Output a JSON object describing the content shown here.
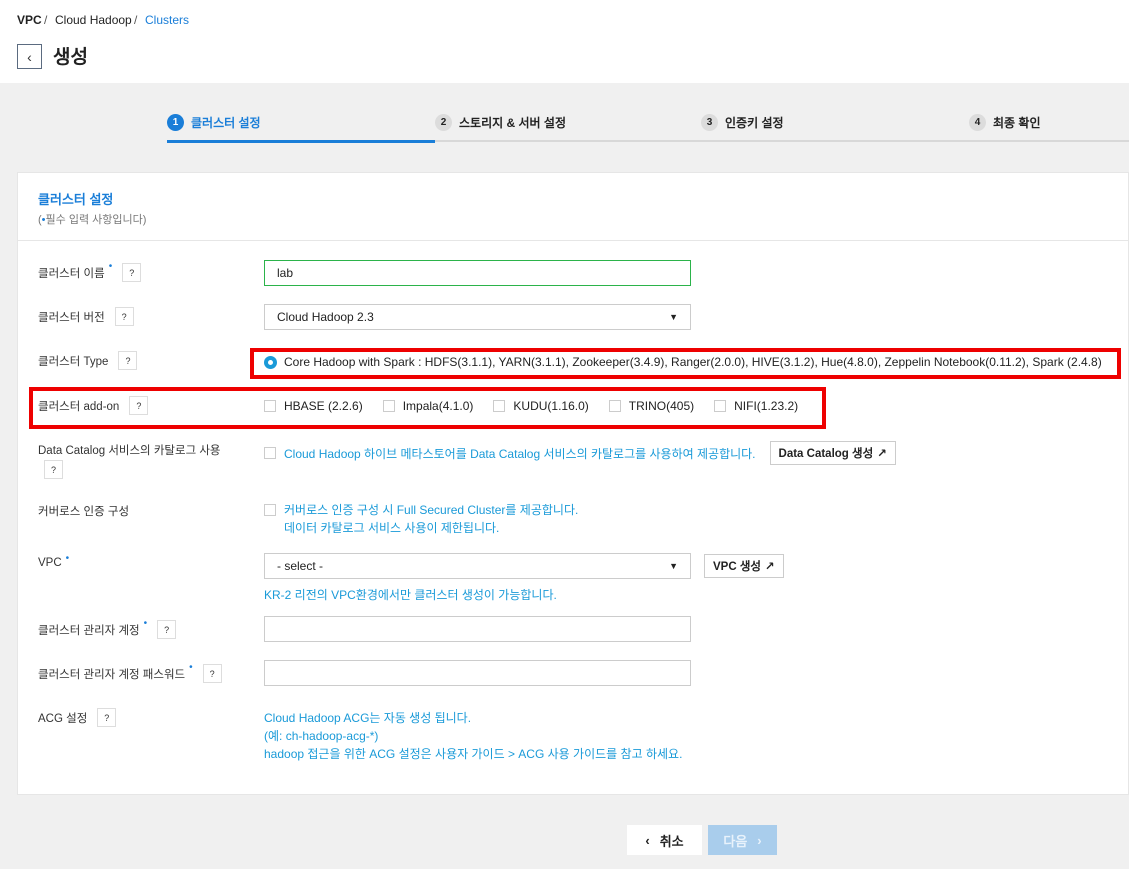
{
  "breadcrumb": {
    "items": [
      "VPC",
      "Cloud Hadoop",
      "Clusters"
    ],
    "sep": "/"
  },
  "page": {
    "title": "생성",
    "back_icon": "chevron-left-icon"
  },
  "steps": [
    {
      "num": "1",
      "label": "클러스터 설정",
      "active": true
    },
    {
      "num": "2",
      "label": "스토리지 & 서버 설정"
    },
    {
      "num": "3",
      "label": "인증키 설정"
    },
    {
      "num": "4",
      "label": "최종 확인"
    }
  ],
  "card": {
    "title": "클러스터 설정",
    "subtitle_open": "(",
    "req_mark": "•",
    "subtitle": "필수 입력 사항입니다)"
  },
  "fields": {
    "name": {
      "label": "클러스터 이름",
      "value": "lab"
    },
    "version": {
      "label": "클러스터 버전",
      "value": "Cloud Hadoop 2.3"
    },
    "type": {
      "label": "클러스터 Type",
      "value": "Core Hadoop with Spark : HDFS(3.1.1), YARN(3.1.1), Zookeeper(3.4.9), Ranger(2.0.0), HIVE(3.1.2), Hue(4.8.0), Zeppelin Notebook(0.11.2), Spark (2.4.8)"
    },
    "addon": {
      "label": "클러스터 add-on",
      "options": [
        "HBASE (2.2.6)",
        "Impala(4.1.0)",
        "KUDU(1.16.0)",
        "TRINO(405)",
        "NIFI(1.23.2)"
      ]
    },
    "catalog": {
      "label": "Data Catalog 서비스의 카탈로그 사용",
      "text": "Cloud Hadoop 하이브 메타스토어를 Data Catalog 서비스의 카탈로그를 사용하여 제공합니다.",
      "button": "Data Catalog 생성"
    },
    "kerberos": {
      "label": "커버로스 인증 구성",
      "text1": "커버로스 인증 구성 시 Full Secured Cluster를 제공합니다.",
      "text2": "데이터 카탈로그 서비스 사용이 제한됩니다."
    },
    "vpc": {
      "label": "VPC",
      "value": "- select -",
      "button": "VPC 생성",
      "hint": "KR-2 리전의 VPC환경에서만 클러스터 생성이 가능합니다."
    },
    "admin": {
      "label": "클러스터 관리자 계정",
      "value": ""
    },
    "password": {
      "label": "클러스터 관리자 계정 패스워드",
      "value": ""
    },
    "acg": {
      "label": "ACG 설정",
      "line1": "Cloud Hadoop ACG는 자동 생성 됩니다.",
      "line2": "(예: ch-hadoop-acg-*)",
      "line3": "hadoop 접근을 위한 ACG 설정은 사용자 가이드 > ACG 사용 가이드를 참고 하세요."
    }
  },
  "footer": {
    "cancel": "취소",
    "next": "다음"
  },
  "colors": {
    "accent": "#1a7ed8",
    "link": "#1a9ad8",
    "highlight": "#ee0000"
  }
}
